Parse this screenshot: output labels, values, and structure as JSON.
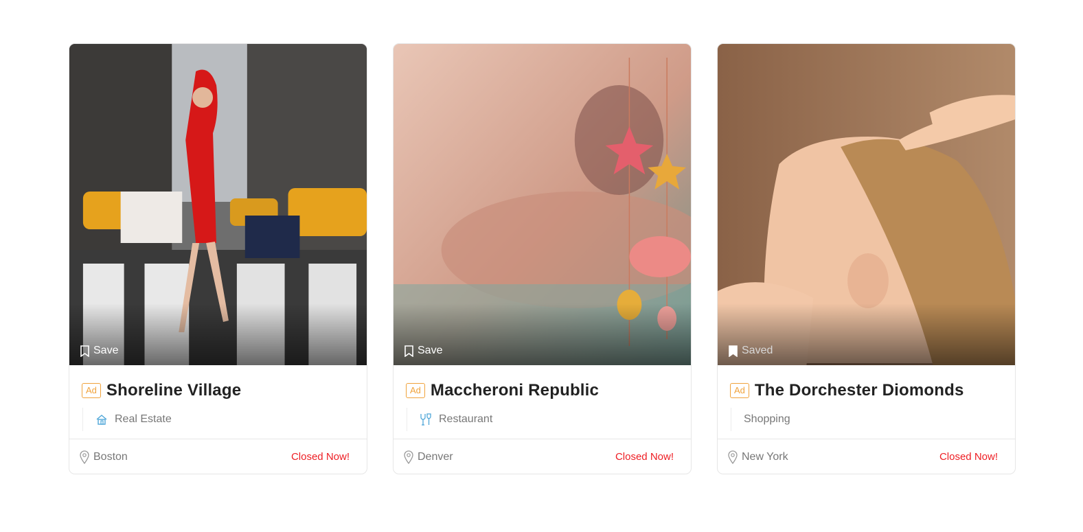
{
  "colors": {
    "ad_badge": "#f0a23a",
    "status_closed": "#ee1d23",
    "category_icon": "#4ea6d8"
  },
  "cards": [
    {
      "save_label": "Save",
      "saved": false,
      "ad_label": "Ad",
      "title": "Shoreline Village",
      "category_icon": "real-estate-icon",
      "category": "Real Estate",
      "location_icon": "map-pin-icon",
      "location": "Boston",
      "status": "Closed Now!"
    },
    {
      "save_label": "Save",
      "saved": false,
      "ad_label": "Ad",
      "title": "Maccheroni Republic",
      "category_icon": "restaurant-icon",
      "category": "Restaurant",
      "location_icon": "map-pin-icon",
      "location": "Denver",
      "status": "Closed Now!"
    },
    {
      "save_label": "Saved",
      "saved": true,
      "ad_label": "Ad",
      "title": "The Dorchester Diomonds",
      "category_icon": "",
      "category": "Shopping",
      "location_icon": "map-pin-icon",
      "location": "New York",
      "status": "Closed Now!"
    }
  ]
}
